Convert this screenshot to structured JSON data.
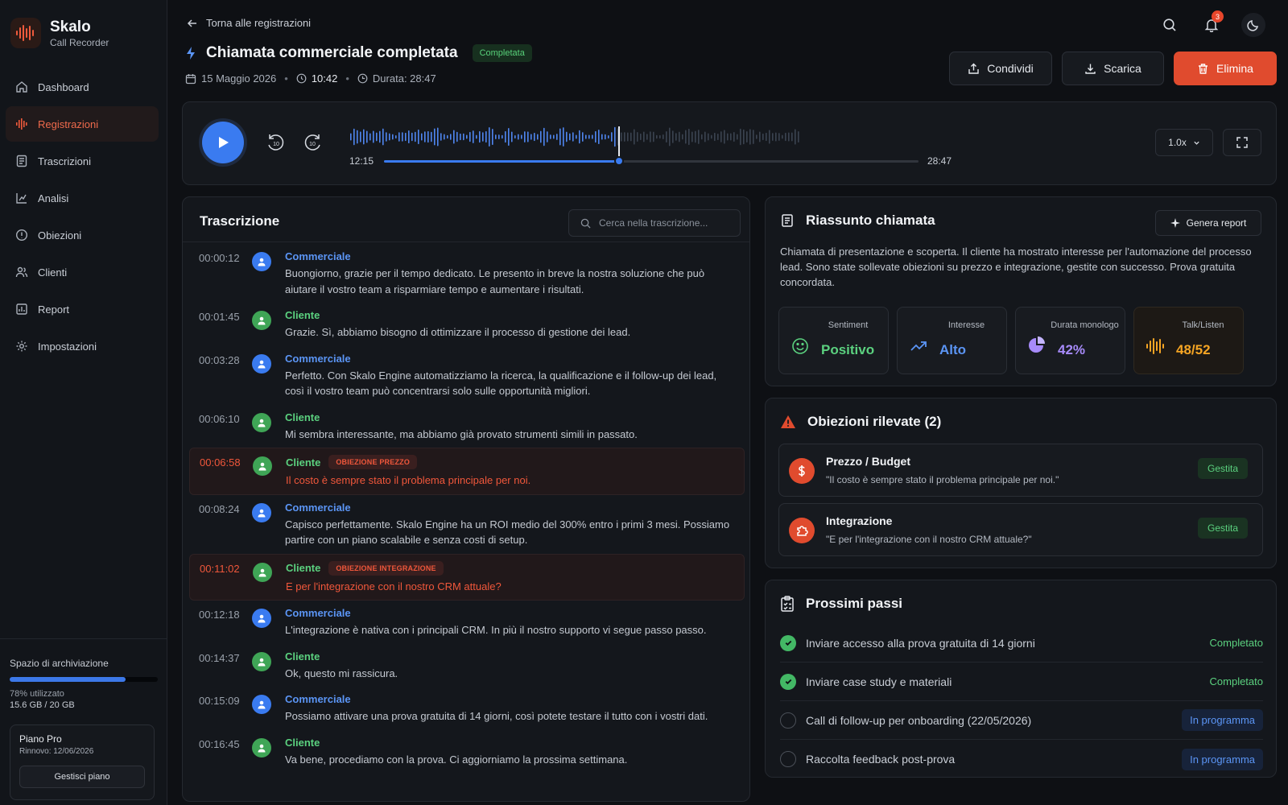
{
  "brand": {
    "name": "Skalo",
    "sub": "Call Recorder"
  },
  "nav": [
    {
      "label": "Dashboard",
      "icon": "home-icon"
    },
    {
      "label": "Registrazioni",
      "icon": "waveform-icon",
      "active": true
    },
    {
      "label": "Trascrizioni",
      "icon": "document-icon"
    },
    {
      "label": "Analisi",
      "icon": "chart-icon"
    },
    {
      "label": "Obiezioni",
      "icon": "alert-circle-icon"
    },
    {
      "label": "Clienti",
      "icon": "users-icon"
    },
    {
      "label": "Report",
      "icon": "report-icon"
    },
    {
      "label": "Impostazioni",
      "icon": "gear-icon"
    }
  ],
  "storage": {
    "title": "Spazio di archiviazione",
    "percent": 78,
    "used_label": "78% utilizzato",
    "used": "15.6 GB",
    "sep": "/",
    "total": "20 GB"
  },
  "plan": {
    "name": "Piano Pro",
    "renewal": "Rinnovo: 12/06/2026",
    "button": "Gestisci piano"
  },
  "header": {
    "back": "Torna alle registrazioni",
    "title": "Chiamata commerciale completata",
    "status": "Completata",
    "date": "15 Maggio 2026",
    "time": "10:42",
    "duration": "Durata: 28:47",
    "notifications": "3"
  },
  "actions": {
    "share": "Condividi",
    "download": "Scarica",
    "delete": "Elimina"
  },
  "player": {
    "current": "12:15",
    "total": "28:47",
    "progress": 0.44,
    "speed": "1.0x",
    "skip_back": "10",
    "skip_forward": "10"
  },
  "transcript": {
    "title": "Trascrizione",
    "search_placeholder": "Cerca nella trascrizione...",
    "rows": [
      {
        "time": "00:00:12",
        "speaker": "Commerciale",
        "role": "sales",
        "text": "Buongiorno, grazie per il tempo dedicato. Le presento in breve la nostra soluzione che può aiutare il vostro team a risparmiare tempo e aumentare i risultati."
      },
      {
        "time": "00:01:45",
        "speaker": "Cliente",
        "role": "client",
        "text": "Grazie. Sì, abbiamo bisogno di ottimizzare il processo di gestione dei lead."
      },
      {
        "time": "00:03:28",
        "speaker": "Commerciale",
        "role": "sales",
        "text": "Perfetto. Con Skalo Engine automatizziamo la ricerca, la qualificazione e il follow-up dei lead, così il vostro team può concentrarsi solo sulle opportunità migliori."
      },
      {
        "time": "00:06:10",
        "speaker": "Cliente",
        "role": "client",
        "text": "Mi sembra interessante, ma abbiamo già provato strumenti simili in passato."
      },
      {
        "time": "00:06:58",
        "speaker": "Cliente",
        "role": "client",
        "objection": "OBIEZIONE PREZZO",
        "text": "Il costo è sempre stato il problema principale per noi."
      },
      {
        "time": "00:08:24",
        "speaker": "Commerciale",
        "role": "sales",
        "text": "Capisco perfettamente. Skalo Engine ha un ROI medio del 300% entro i primi 3 mesi. Possiamo partire con un piano scalabile e senza costi di setup."
      },
      {
        "time": "00:11:02",
        "speaker": "Cliente",
        "role": "client",
        "objection": "OBIEZIONE INTEGRAZIONE",
        "text": "E per l'integrazione con il nostro CRM attuale?"
      },
      {
        "time": "00:12:18",
        "speaker": "Commerciale",
        "role": "sales",
        "text": "L'integrazione è nativa con i principali CRM. In più il nostro supporto vi segue passo passo."
      },
      {
        "time": "00:14:37",
        "speaker": "Cliente",
        "role": "client",
        "text": "Ok, questo mi rassicura."
      },
      {
        "time": "00:15:09",
        "speaker": "Commerciale",
        "role": "sales",
        "text": "Possiamo attivare una prova gratuita di 14 giorni, così potete testare il tutto con i vostri dati."
      },
      {
        "time": "00:16:45",
        "speaker": "Cliente",
        "role": "client",
        "text": "Va bene, procediamo con la prova. Ci aggiorniamo la prossima settimana."
      }
    ]
  },
  "summary": {
    "title": "Riassunto chiamata",
    "button": "Genera report",
    "text": "Chiamata di presentazione e scoperta. Il cliente ha mostrato interesse per l'automazione del processo lead. Sono state sollevate obiezioni su prezzo e integrazione, gestite con successo. Prova gratuita concordata.",
    "stats": [
      {
        "label": "Sentiment",
        "value": "Positivo",
        "color": "#5bd17f",
        "icon": "smile-icon"
      },
      {
        "label": "Interesse",
        "value": "Alto",
        "color": "#5b95f5",
        "icon": "trending-up-icon"
      },
      {
        "label": "Durata monologo",
        "value": "42%",
        "color": "#a78bfa",
        "icon": "pie-chart-icon"
      },
      {
        "label": "Talk/Listen",
        "value": "48/52",
        "color": "#f5a524",
        "icon": "audio-wave-icon"
      }
    ]
  },
  "objections": {
    "title": "Obiezioni rilevate (2)",
    "items": [
      {
        "title": "Prezzo / Budget",
        "quote": "\"Il costo è sempre stato il problema principale per noi.\"",
        "status": "Gestita",
        "icon": "dollar-icon"
      },
      {
        "title": "Integrazione",
        "quote": "\"E per l'integrazione con il nostro CRM attuale?\"",
        "status": "Gestita",
        "icon": "puzzle-icon"
      }
    ]
  },
  "next_steps": {
    "title": "Prossimi passi",
    "items": [
      {
        "text": "Inviare accesso alla prova gratuita di 14 giorni",
        "status": "Completato",
        "done": true
      },
      {
        "text": "Inviare case study e materiali",
        "status": "Completato",
        "done": true
      },
      {
        "text": "Call di follow-up per onboarding (22/05/2026)",
        "status": "In programma",
        "done": false
      },
      {
        "text": "Raccolta feedback post-prova",
        "status": "In programma",
        "done": false
      }
    ]
  }
}
